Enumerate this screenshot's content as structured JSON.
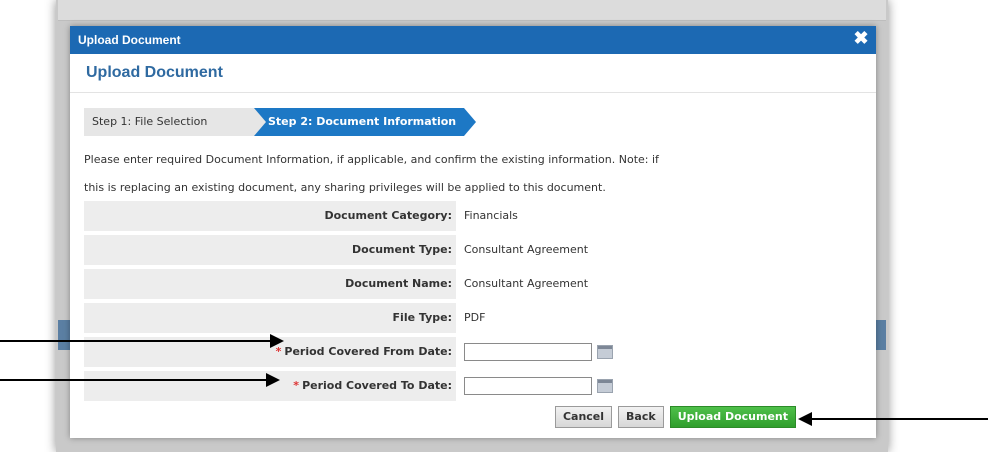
{
  "modal": {
    "title": "Upload Document",
    "close_glyph": "✖",
    "header": "Upload Document"
  },
  "steps": {
    "step1": "Step 1: File Selection",
    "step2": "Step 2: Document Information"
  },
  "instructions": {
    "line1": "Please enter required Document Information, if applicable, and confirm the existing information. Note: if",
    "line2": "this is replacing an existing document, any sharing privileges will be applied to this document."
  },
  "form": {
    "category_label": "Document Category:",
    "category_value": "Financials",
    "type_label": "Document Type:",
    "type_value": "Consultant Agreement",
    "name_label": "Document Name:",
    "name_value": "Consultant Agreement",
    "filetype_label": "File Type:",
    "filetype_value": "PDF",
    "required_mark": "*",
    "from_label": "Period Covered From Date:",
    "from_value": "",
    "to_label": "Period Covered To Date:",
    "to_value": ""
  },
  "buttons": {
    "cancel": "Cancel",
    "back": "Back",
    "upload": "Upload Document"
  },
  "colors": {
    "titlebar": "#1c69b3",
    "active_step": "#1d78c5",
    "upload_button": "#2f9e2c",
    "required": "#d33333"
  },
  "icons": [
    "close-icon",
    "calendar-icon",
    "calendar-icon"
  ]
}
